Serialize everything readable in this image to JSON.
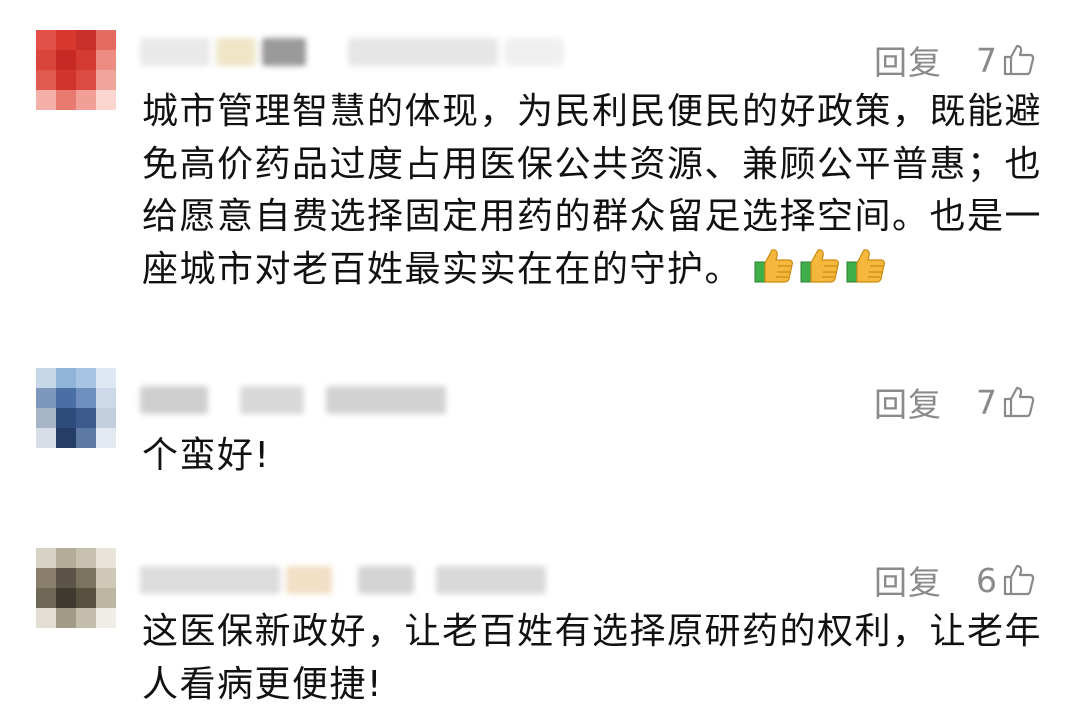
{
  "comments": [
    {
      "reply_label": "回复",
      "likes": "7",
      "text": "城市管理智慧的体现，为民利民便民的好政策，既能避免高价药品过度占用医保公共资源、兼顾公平普惠；也给愿意自费选择固定用药的群众留足选择空间。也是一座城市对老百姓最实实在在的守护。",
      "emoji": [
        "thumbs-up-emoji",
        "thumbs-up-emoji",
        "thumbs-up-emoji"
      ],
      "avatar_colors": [
        "#d9534a",
        "#c9302c",
        "#e05a4f",
        "#f4b0a8"
      ]
    },
    {
      "reply_label": "回复",
      "likes": "7",
      "text": "个蛮好!",
      "avatar_colors": [
        "#4a6fa5",
        "#2f4b7c",
        "#8fb3d9",
        "#c6d7ea"
      ]
    },
    {
      "reply_label": "回复",
      "likes": "6",
      "text": "这医保新政好，让老百姓有选择原研药的权利，让老年人看病更便捷!",
      "avatar_colors": [
        "#8a7f6a",
        "#5c5547",
        "#b3ab98",
        "#d8d3c6"
      ]
    }
  ],
  "icons": {
    "like": "thumbs-up-outline-icon"
  },
  "colors": {
    "meta_text": "#8a8a8a",
    "body_text": "#111111",
    "emoji_yellow": "#f5b83d",
    "emoji_green": "#3fae49"
  }
}
